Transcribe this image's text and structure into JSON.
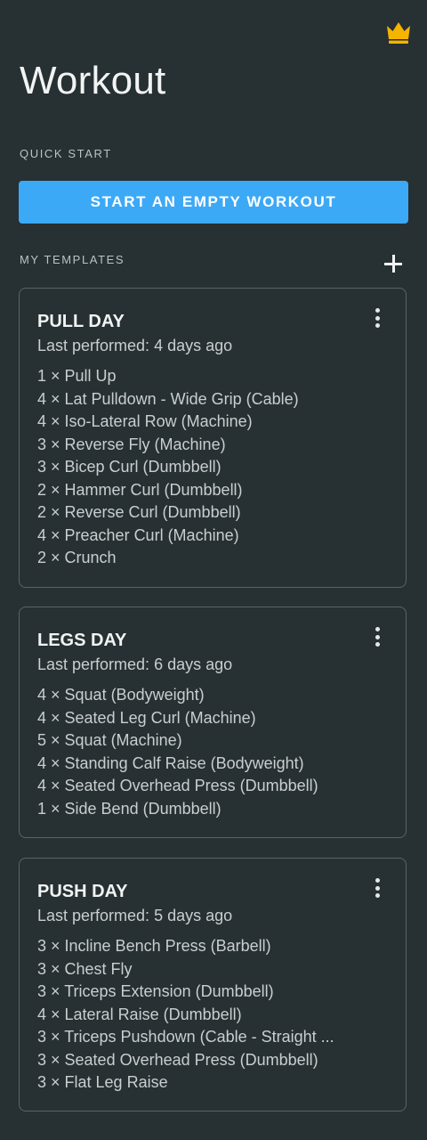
{
  "header": {
    "title": "Workout",
    "crown_icon": "crown-icon",
    "crown_color": "#f4b400"
  },
  "quick_start": {
    "label": "QUICK START",
    "button_label": "START AN EMPTY WORKOUT",
    "button_color": "#3ca9f6"
  },
  "templates": {
    "label": "MY TEMPLATES",
    "add_icon": "plus-icon",
    "items": [
      {
        "name": "PULL DAY",
        "last_performed": "Last performed: 4 days ago",
        "exercises": [
          "1 × Pull Up",
          "4 × Lat Pulldown - Wide Grip (Cable)",
          "4 × Iso-Lateral Row (Machine)",
          "3 × Reverse Fly (Machine)",
          "3 × Bicep Curl (Dumbbell)",
          "2 × Hammer Curl (Dumbbell)",
          "2 × Reverse Curl (Dumbbell)",
          "4 × Preacher Curl (Machine)",
          "2 × Crunch"
        ]
      },
      {
        "name": "LEGS DAY",
        "last_performed": "Last performed: 6 days ago",
        "exercises": [
          "4 × Squat (Bodyweight)",
          "4 × Seated Leg Curl (Machine)",
          "5 × Squat (Machine)",
          "4 × Standing Calf Raise (Bodyweight)",
          "4 × Seated Overhead Press (Dumbbell)",
          "1 × Side Bend (Dumbbell)"
        ]
      },
      {
        "name": "PUSH DAY",
        "last_performed": "Last performed: 5 days ago",
        "exercises": [
          "3 × Incline Bench Press (Barbell)",
          "3 × Chest Fly",
          "3 × Triceps Extension (Dumbbell)",
          "4 × Lateral Raise (Dumbbell)",
          "3 × Triceps Pushdown (Cable - Straight ...",
          "3 × Seated Overhead Press (Dumbbell)",
          "3 × Flat Leg Raise"
        ]
      }
    ]
  }
}
